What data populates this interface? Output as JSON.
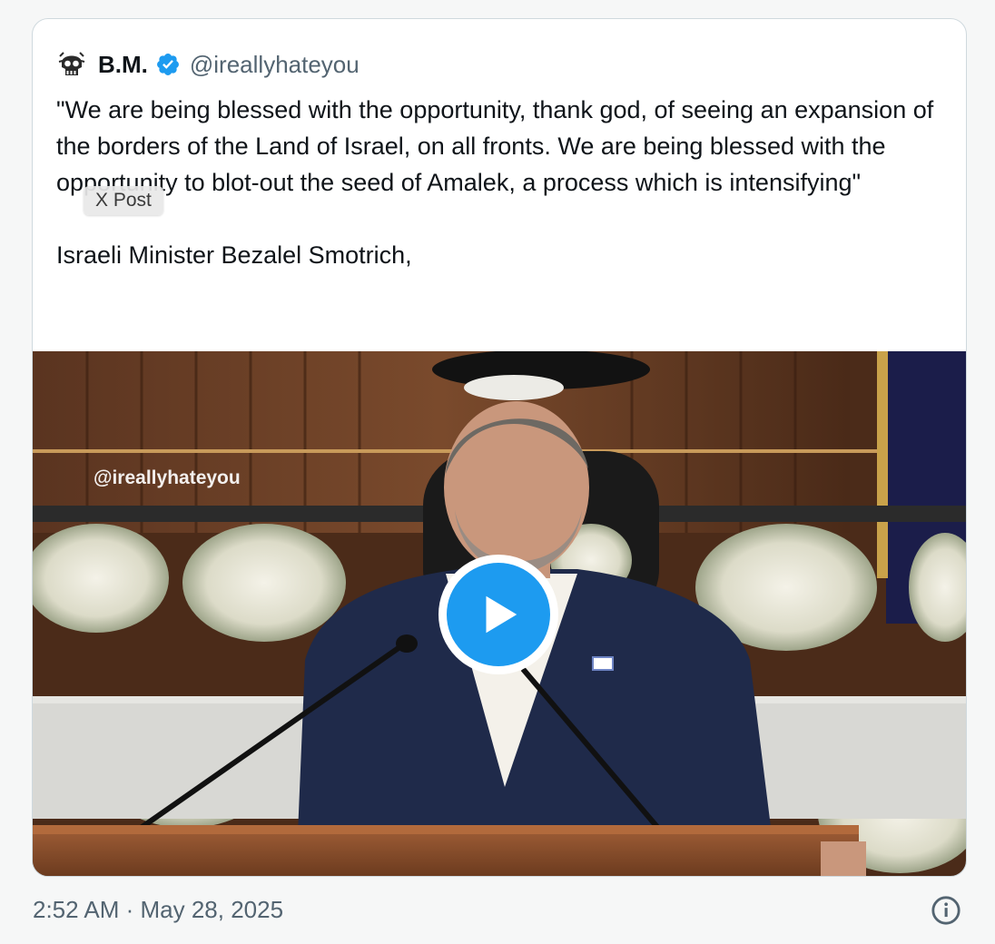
{
  "post": {
    "display_name": "B.M.",
    "handle": "@ireallyhateyou",
    "verified_icon": "verified-badge-icon",
    "text": "\"We are being blessed with the opportunity, thank god, of seeing an expansion of the borders of the Land of Israel, on all fronts. We are being blessed with the opportunity to blot-out the seed of Amalek, a process which is intensifying\"\n\nIsraeli Minister Bezalel Smotrich,",
    "tooltip": "X Post",
    "timestamp": "2:52 AM · May 28, 2025"
  },
  "media": {
    "watermark": "@ireallyhateyou",
    "play_icon": "play-icon"
  },
  "colors": {
    "accent": "#1d9bf0",
    "text": "#0f1419",
    "secondary": "#536471",
    "border": "#cfd9de"
  },
  "icons": {
    "avatar": "skull-avatar-icon",
    "info": "info-icon"
  }
}
